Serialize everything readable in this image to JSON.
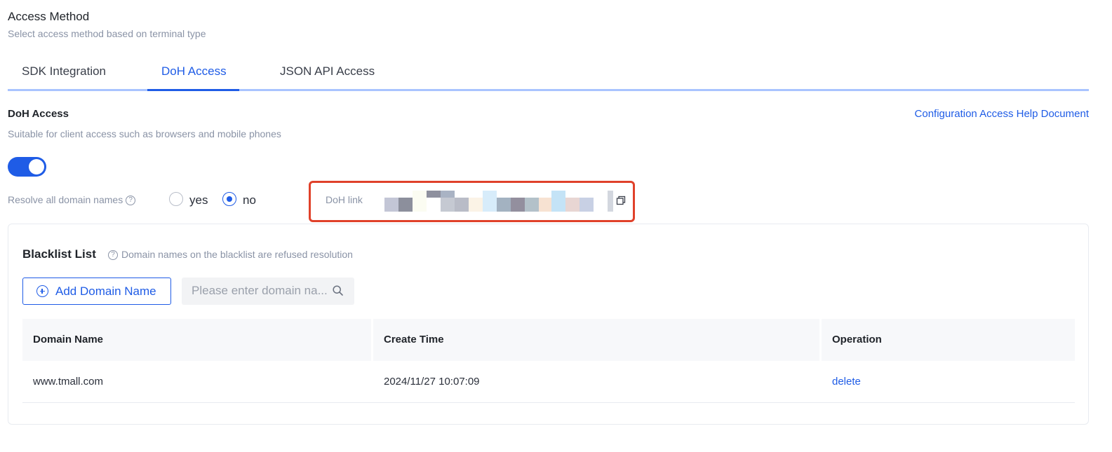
{
  "header": {
    "title": "Access Method",
    "subtitle": "Select access method based on terminal type"
  },
  "tabs": [
    {
      "label": "SDK Integration",
      "active": false
    },
    {
      "label": "DoH Access",
      "active": true
    },
    {
      "label": "JSON API Access",
      "active": false
    }
  ],
  "doh": {
    "title": "DoH Access",
    "help_link": "Configuration Access Help Document",
    "description": "Suitable for client access such as browsers and mobile phones",
    "enabled": true,
    "resolve_all_label": "Resolve all domain names",
    "resolve_all_help_icon": "question-circle-icon",
    "options": [
      {
        "label": "yes",
        "checked": false
      },
      {
        "label": "no",
        "checked": true
      }
    ],
    "link_label": "DoH link",
    "link_value_redacted": true,
    "copy_icon": "copy-icon",
    "highlight_color": "#e0412a"
  },
  "blacklist": {
    "title": "Blacklist List",
    "hint": "Domain names on the blacklist are refused resolution",
    "add_button": "Add Domain Name",
    "search_placeholder": "Please enter domain na...",
    "columns": [
      "Domain Name",
      "Create Time",
      "Operation"
    ],
    "rows": [
      {
        "domain": "www.tmall.com",
        "created": "2024/11/27 10:07:09",
        "operation": "delete"
      }
    ]
  },
  "colors": {
    "accent": "#1f5ce6",
    "muted_text": "#8a93a6",
    "tab_underline": "#a9c4ff"
  }
}
